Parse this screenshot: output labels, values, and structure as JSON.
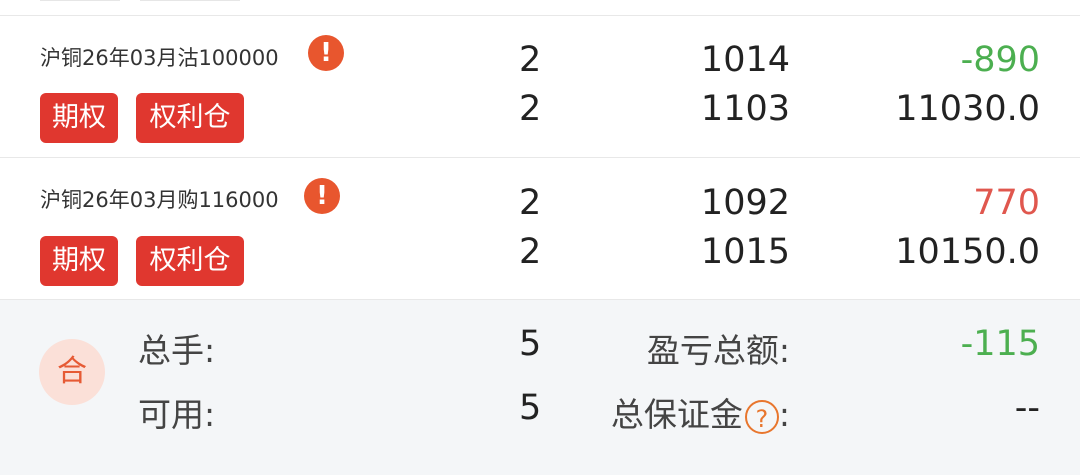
{
  "positions": [
    {
      "name": "沪铜26年03月沽100000",
      "warn_icon": "!",
      "tags": [
        "期权",
        "权利仓"
      ],
      "qty_top": "2",
      "qty_bottom": "2",
      "price_top": "1014",
      "price_bottom": "1103",
      "pnl": "-890",
      "pnl_color": "#4caf50",
      "value": "11030.0"
    },
    {
      "name": "沪铜26年03月购116000",
      "warn_icon": "!",
      "tags": [
        "期权",
        "权利仓"
      ],
      "qty_top": "2",
      "qty_bottom": "2",
      "price_top": "1092",
      "price_bottom": "1015",
      "pnl": "770",
      "pnl_color": "#e0574e",
      "value": "10150.0"
    }
  ],
  "summary": {
    "badge": "合",
    "total_hands_label": "总手:",
    "total_hands_value": "5",
    "available_label": "可用:",
    "available_value": "5",
    "pnl_total_label": "盈亏总额:",
    "pnl_total_value": "-115",
    "pnl_total_color": "#4caf50",
    "margin_label": "总保证金",
    "margin_help_icon": "?",
    "margin_colon": ":",
    "margin_value": "--"
  }
}
